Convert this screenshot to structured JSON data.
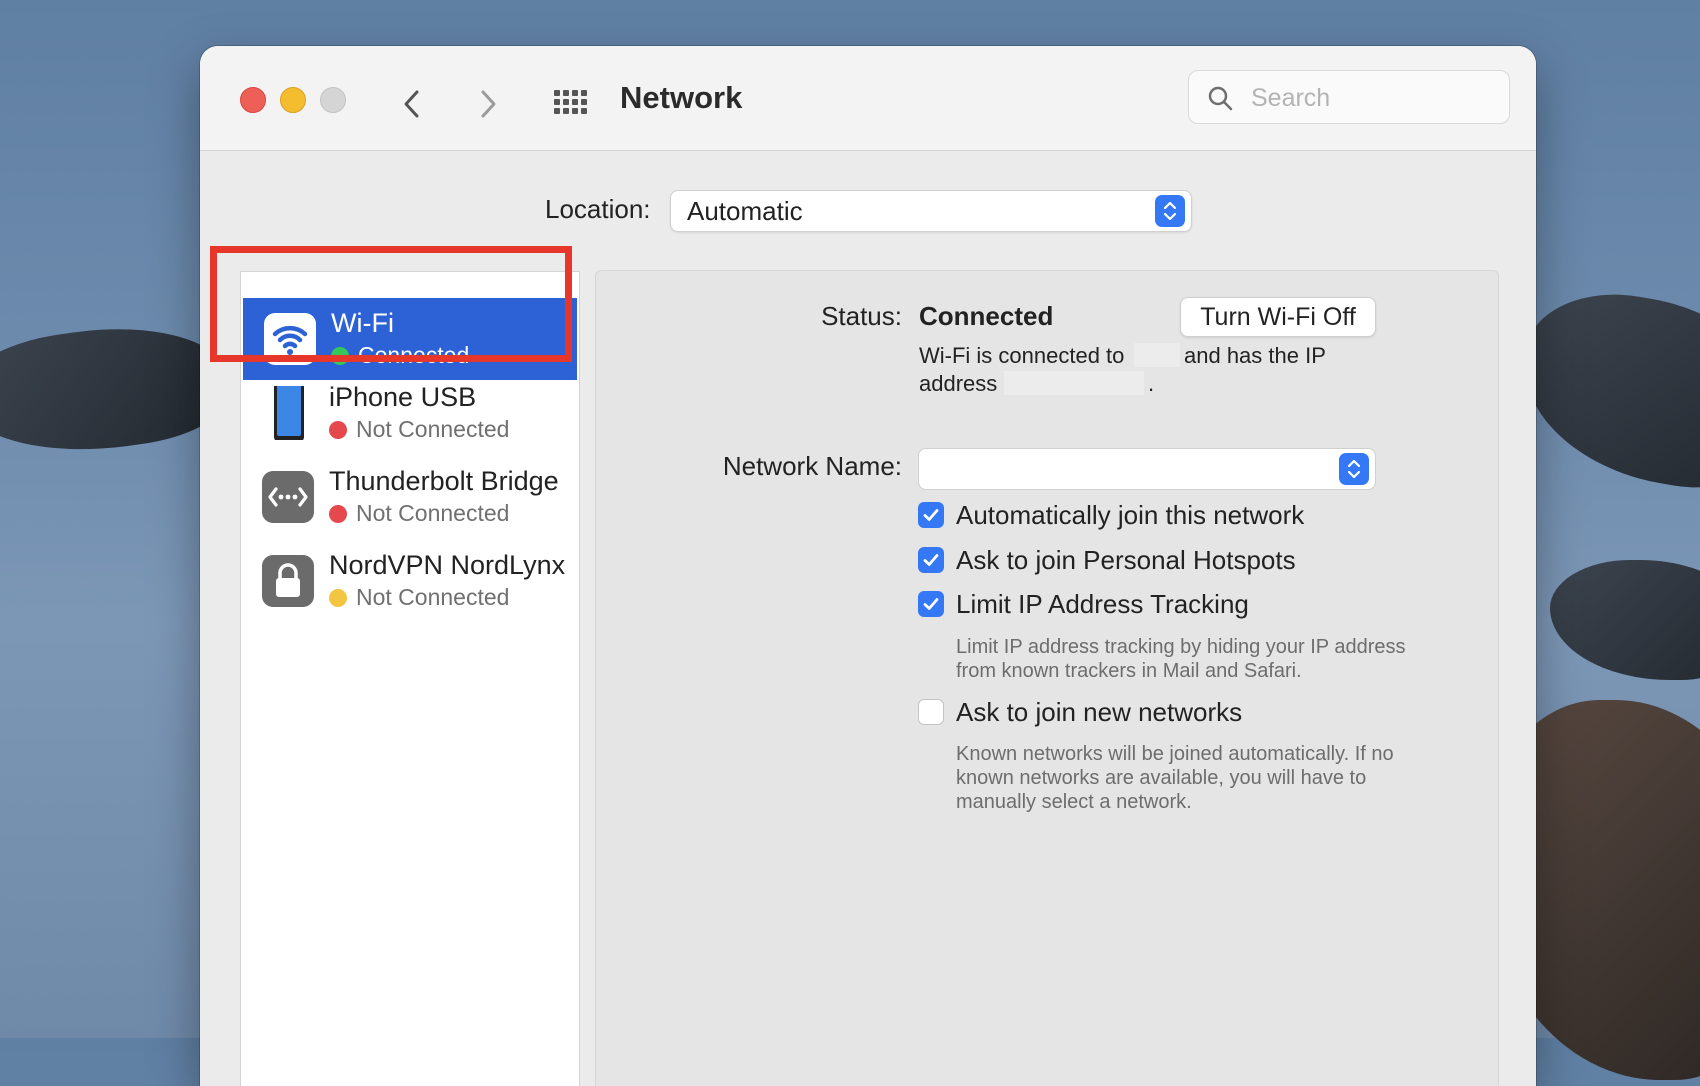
{
  "window": {
    "title": "Network",
    "search_placeholder": "Search"
  },
  "location": {
    "label": "Location:",
    "value": "Automatic"
  },
  "services": [
    {
      "name": "Wi-Fi",
      "status": "Connected",
      "status_color": "#34c759",
      "icon": "wifi-icon",
      "selected": true
    },
    {
      "name": "iPhone USB",
      "status": "Not Connected",
      "status_color": "#e5484d",
      "icon": "iphone-icon"
    },
    {
      "name": "Thunderbolt Bridge",
      "status": "Not Connected",
      "status_color": "#e5484d",
      "icon": "thunderbolt-bridge-icon"
    },
    {
      "name": "NordVPN NordLynx",
      "status": "Not Connected",
      "status_color": "#f4c542",
      "icon": "lock-icon"
    }
  ],
  "detail": {
    "status_label": "Status:",
    "status_value": "Connected",
    "turn_off_button": "Turn Wi-Fi Off",
    "connection_desc_1": "Wi-Fi is connected to",
    "connection_desc_2": "and has the IP",
    "connection_desc_3": "address",
    "connection_desc_end": ".",
    "network_name_label": "Network Name:",
    "network_name_value": "",
    "options": [
      {
        "label": "Automatically join this network",
        "checked": true
      },
      {
        "label": "Ask to join Personal Hotspots",
        "checked": true
      },
      {
        "label": "Limit IP Address Tracking",
        "checked": true
      },
      {
        "label": "Ask to join new networks",
        "checked": false
      }
    ],
    "limit_tracking_help": "Limit IP address tracking by hiding your IP address from known trackers in Mail and Safari.",
    "new_networks_help": "Known networks will be joined automatically. If no known networks are available, you will have to manually select a network."
  },
  "colors": {
    "accent": "#3478f6",
    "selection": "#2c62d6",
    "highlight_box": "#e7372a"
  }
}
